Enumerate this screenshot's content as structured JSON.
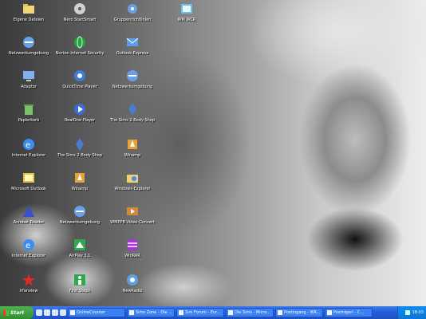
{
  "desktop": {
    "icons": [
      {
        "label": "Eigene Dateien",
        "icon": "folder-icon",
        "color": "#f2d675"
      },
      {
        "label": "Netzwerkumgebung",
        "icon": "network-icon",
        "color": "#6aa0e8"
      },
      {
        "label": "Adaptor",
        "icon": "computer-icon",
        "color": "#7fb0f0"
      },
      {
        "label": "Norton Internet Security",
        "icon": "globe-icon",
        "color": "#2f9f3f"
      },
      {
        "label": "Outlook Express",
        "icon": "mail-icon",
        "color": "#5e9ee8"
      },
      {
        "label": "Netzwerkumgebung",
        "icon": "network-icon",
        "color": "#6aa0e8"
      },
      {
        "label": "QuickTime Player",
        "icon": "quicktime-icon",
        "color": "#3c7dd8"
      },
      {
        "label": "Papierkorb",
        "icon": "recycle-bin-icon",
        "color": "#7ebf6a"
      },
      {
        "label": "RealOne Player",
        "icon": "player-icon",
        "color": "#3b6ed0"
      },
      {
        "label": "Internet Explorer",
        "icon": "ie-icon",
        "color": "#3a8ef0"
      },
      {
        "label": "The Sims 2 Body Shop",
        "icon": "sims-icon",
        "color": "#4a7dd0"
      },
      {
        "label": "Microsoft Outlook",
        "icon": "outlook-icon",
        "color": "#e8c23a"
      },
      {
        "label": "Windows-Explorer",
        "icon": "explorer-icon",
        "color": "#f0d070"
      },
      {
        "label": "Acrobat Reader",
        "icon": "acrobat-icon",
        "color": "#3a4fd0"
      },
      {
        "label": "WMPPB Video Convert",
        "icon": "video-icon",
        "color": "#d08a3a"
      },
      {
        "label": "Internet Explorer",
        "icon": "ie-icon",
        "color": "#3a8ef0"
      },
      {
        "label": "AirPlay 3.1",
        "icon": "airplay-icon",
        "color": "#2fa84f"
      },
      {
        "label": "WinRAR",
        "icon": "winrar-icon",
        "color": "#a03ad0"
      },
      {
        "label": "irfanview",
        "icon": "irfanview-icon",
        "color": "#e02a2a"
      },
      {
        "label": "First Steps",
        "icon": "first-steps-icon",
        "color": "#2fa84f"
      },
      {
        "label": "NewRadio",
        "icon": "radio-icon",
        "color": "#5ea0e0"
      },
      {
        "label": "Nero StartSmart",
        "icon": "nero-icon",
        "color": "#d0d0d0"
      },
      {
        "label": "Netzwerkumgebung",
        "icon": "network-icon",
        "color": "#6aa0e8"
      },
      {
        "label": "Gruppenrichtlinien",
        "icon": "settings-icon",
        "color": "#6aa0e8"
      },
      {
        "label": "Winamp",
        "icon": "winamp-icon",
        "color": "#e8a03a"
      },
      {
        "label": "WM WCR",
        "icon": "wm-icon",
        "color": "#6abfe8"
      }
    ]
  },
  "taskbar": {
    "start_label": "Start",
    "quick_launch": [
      "ie-icon",
      "desktop-icon",
      "mail-icon",
      "media-icon"
    ],
    "tasks": [
      "OnlineCounter",
      "Sims Zone - Die ...",
      "Sim Forum - Eur...",
      "Die Sims - Micro...",
      "Postingang - WR...",
      "Postnigeri - C..."
    ],
    "clock": "18:03"
  }
}
